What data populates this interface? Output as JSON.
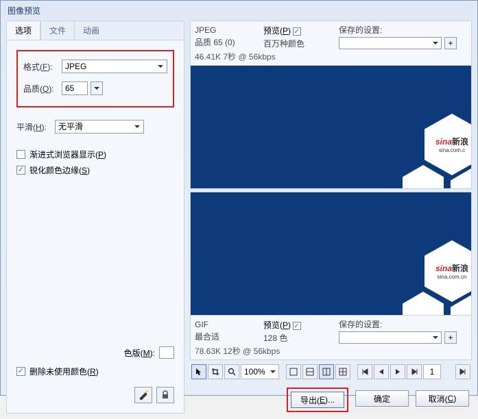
{
  "window": {
    "title": "图像预览"
  },
  "tabs": {
    "options": "选项",
    "file": "文件",
    "anim": "动画"
  },
  "format": {
    "label_pre": "格式(",
    "hotkey": "F",
    "label_post": "):",
    "value": "JPEG"
  },
  "quality": {
    "label_pre": "品质(",
    "hotkey": "Q",
    "label_post": "):",
    "value": "65"
  },
  "smooth": {
    "label_pre": "平滑(",
    "hotkey": "H",
    "label_post": "):",
    "value": "无平滑"
  },
  "progressive": {
    "label_pre": "渐进式浏览器显示(",
    "hotkey": "P",
    "label_post": ")",
    "checked": false
  },
  "sharpen": {
    "label_pre": "锐化颜色边缘(",
    "hotkey": "S",
    "label_post": ")",
    "checked": true
  },
  "palette": {
    "label_pre": "色版(",
    "hotkey": "M",
    "label_post": "):"
  },
  "remove_unused": {
    "label_pre": "删除未使用颜色(",
    "hotkey": "R",
    "label_post": ")",
    "checked": true
  },
  "preview1": {
    "fmt": "JPEG",
    "preview_label_pre": "预览(",
    "preview_hotkey": "P",
    "preview_label_post": ")",
    "quality_line": "品质 65 (0)",
    "colors": "百万种颜色",
    "saved_label": "保存的设置:",
    "stats": "46.41K  7秒 @ 56kbps",
    "logo_text": "sina",
    "logo_cn": "新浪",
    "logo_sub": "sina.com.c"
  },
  "preview2": {
    "fmt": "GIF",
    "preview_label_pre": "预览(",
    "preview_hotkey": "P",
    "preview_label_post": ")",
    "quality_line": "最合适",
    "colors": "128 色",
    "saved_label": "保存的设置:",
    "stats": "78.63K  12秒 @ 56kbps",
    "logo_text": "sina",
    "logo_cn": "新浪",
    "logo_sub": "sina.com.cn"
  },
  "toolbar": {
    "zoom": "100%",
    "frame": "1"
  },
  "buttons": {
    "export_pre": "导出(",
    "export_hk": "E",
    "export_post": ")...",
    "ok": "确定",
    "cancel_pre": "取消(",
    "cancel_hk": "C",
    "cancel_post": ")"
  }
}
